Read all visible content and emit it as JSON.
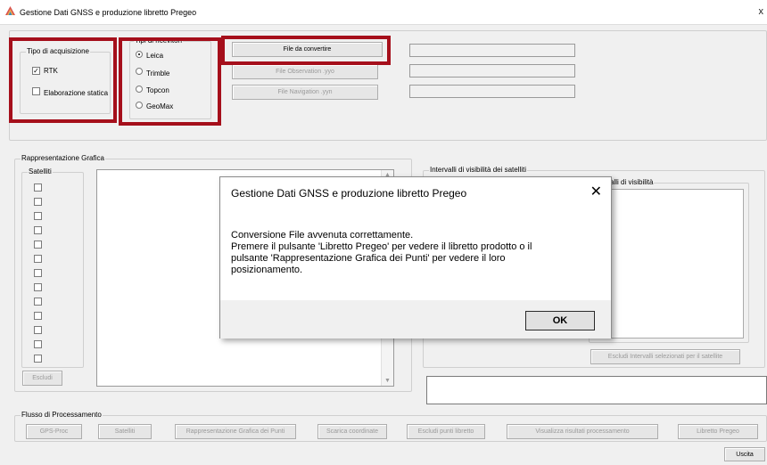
{
  "window": {
    "title": "Gestione Dati GNSS e produzione libretto Pregeo",
    "close": "x"
  },
  "acquisizione": {
    "legend": "Tipo di acquisizione",
    "options": [
      {
        "label": "RTK",
        "checked": true
      },
      {
        "label": "Elaborazione statica",
        "checked": false
      }
    ]
  },
  "ricevitori": {
    "legend": "Tipi di ricevitori",
    "options": [
      {
        "label": "Leica",
        "selected": true
      },
      {
        "label": "Trimble"
      },
      {
        "label": "Topcon"
      },
      {
        "label": "GeoMax"
      }
    ]
  },
  "files": {
    "convert": "File da convertire",
    "observation": "File Observation .yyo",
    "navigation": "File Navigation .yyn"
  },
  "grafica": {
    "legend": "Rappresentazione Grafica",
    "satelliti": "Satelliti",
    "escludi": "Escludi"
  },
  "visibilita": {
    "legend": "Intervalli di visibilità dei satelliti",
    "inner_legend": "Intervalli di visibilità",
    "exclude_btn": "Escludi Intervalli selezionati per il satellite"
  },
  "flusso": {
    "legend": "Flusso di Processamento",
    "buttons": [
      "GPS-Proc",
      "Satelliti",
      "Rappresentazione Grafica dei Punti",
      "Scarica coordinate",
      "Escludi punti libretto",
      "Visualizza risultati processamento",
      "Libretto Pregeo"
    ]
  },
  "uscita": "Uscita",
  "dialog": {
    "title": "Gestione Dati GNSS e produzione libretto Pregeo",
    "close": "✕",
    "line1": "Conversione File avvenuta correttamente.",
    "line2": "Premere il pulsante 'Libretto Pregeo' per vedere il libretto prodotto o il",
    "line3": "pulsante 'Rappresentazione Grafica dei Punti' per vedere il loro",
    "line4": "posizionamento.",
    "ok": "OK"
  },
  "colors": {
    "highlight": "#a50f1b"
  }
}
